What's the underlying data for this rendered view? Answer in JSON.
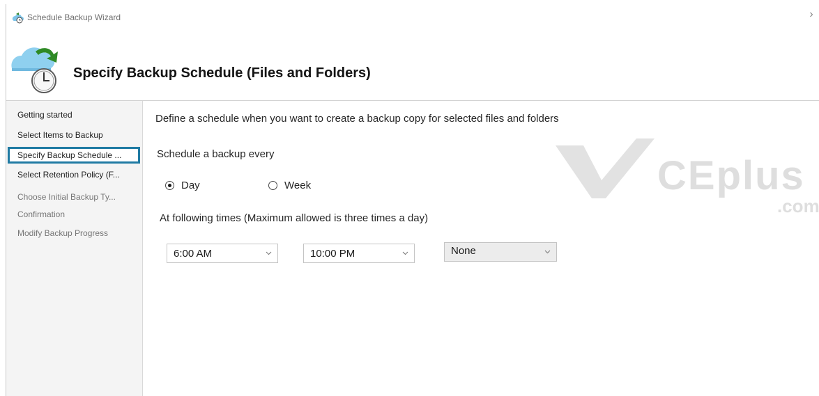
{
  "window": {
    "title": "Schedule Backup Wizard",
    "close_glyph": "›"
  },
  "header": {
    "title": "Specify Backup Schedule (Files and Folders)",
    "icon": "backup-clock-icon"
  },
  "nav": {
    "items": [
      {
        "label": "Getting started",
        "state": "normal"
      },
      {
        "label": "Select Items to Backup",
        "state": "normal"
      },
      {
        "label": "Specify Backup Schedule ...",
        "state": "active"
      },
      {
        "label": "Select Retention Policy (F...",
        "state": "normal"
      },
      {
        "label": "Choose Initial Backup Ty...",
        "state": "disabled"
      },
      {
        "label": "Confirmation",
        "state": "disabled"
      },
      {
        "label": "Modify Backup Progress",
        "state": "disabled"
      }
    ]
  },
  "content": {
    "description": "Define a schedule when you want to create a backup copy for selected files and folders",
    "schedule_label": "Schedule a backup every",
    "radio_day": "Day",
    "radio_week": "Week",
    "selected_frequency": "Day",
    "times_label": "At following times (Maximum allowed is three times a day)",
    "time_1": "6:00 AM",
    "time_2": "10:00 PM",
    "time_3": "None"
  },
  "watermark": {
    "text": "CEplus",
    "suffix": ".com"
  },
  "colors": {
    "active_border": "#1f7aa3",
    "nav_background": "#f4f4f4"
  }
}
